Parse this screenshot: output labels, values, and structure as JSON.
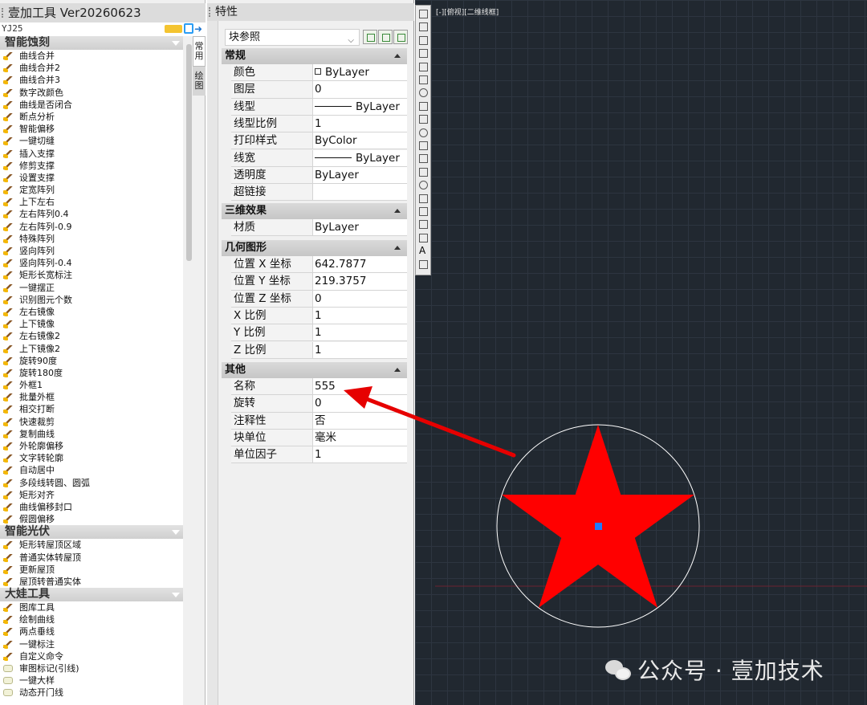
{
  "left_panel": {
    "title": "壹加工具 Ver20260623",
    "version_tag": "YJ25",
    "side_tabs": [
      "常用",
      "绘图"
    ],
    "groups": [
      {
        "name": "智能蚀刻",
        "items": [
          "曲线合并",
          "曲线合并2",
          "曲线合并3",
          "数字改颜色",
          "曲线是否闭合",
          "断点分析",
          "智能偏移",
          "一键切缝",
          "插入支撑",
          "修剪支撑",
          "设置支撑",
          "定宽阵列",
          "上下左右",
          "左右阵列0.4",
          "左右阵列-0.9",
          "特殊阵列",
          "竖向阵列",
          "竖向阵列-0.4",
          "矩形长宽标注",
          "一键摆正",
          "识别图元个数",
          "左右镜像",
          "上下镜像",
          "左右镜像2",
          "上下镜像2",
          "旋转90度",
          "旋转180度",
          "外框1",
          "批量外框",
          "相交打断",
          "快速裁剪",
          "复制曲线",
          "外轮廓偏移",
          "文字转轮廓",
          "自动居中",
          "多段线转圆、圆弧",
          "矩形对齐",
          "曲线偏移封口",
          "假圆偏移"
        ]
      },
      {
        "name": "智能光伏",
        "items": [
          "矩形转屋顶区域",
          "普通实体转屋顶",
          "更新屋顶",
          "屋顶转普通实体"
        ]
      },
      {
        "name": "大娃工具",
        "items": [
          "图库工具",
          "绘制曲线",
          "两点垂线",
          "一键标注",
          "自定义命令",
          "审图标记(引线)",
          "一键大样",
          "动态开门线"
        ]
      }
    ]
  },
  "props_panel": {
    "title": "特性",
    "selector_value": "块参照",
    "sections": [
      {
        "name": "常规",
        "rows": [
          {
            "name": "颜色",
            "value": "ByLayer",
            "marker": "square"
          },
          {
            "name": "图层",
            "value": "0"
          },
          {
            "name": "线型",
            "value": "ByLayer",
            "marker": "line"
          },
          {
            "name": "线型比例",
            "value": "1"
          },
          {
            "name": "打印样式",
            "value": "ByColor"
          },
          {
            "name": "线宽",
            "value": "ByLayer",
            "marker": "line"
          },
          {
            "name": "透明度",
            "value": "ByLayer"
          },
          {
            "name": "超链接",
            "value": ""
          }
        ]
      },
      {
        "name": "三维效果",
        "rows": [
          {
            "name": "材质",
            "value": "ByLayer"
          }
        ]
      },
      {
        "name": "几何图形",
        "rows": [
          {
            "name": "位置 X 坐标",
            "value": "642.7877"
          },
          {
            "name": "位置 Y 坐标",
            "value": "219.3757"
          },
          {
            "name": "位置 Z 坐标",
            "value": "0"
          },
          {
            "name": "X 比例",
            "value": "1"
          },
          {
            "name": "Y 比例",
            "value": "1"
          },
          {
            "name": "Z 比例",
            "value": "1"
          }
        ]
      },
      {
        "name": "其他",
        "rows": [
          {
            "name": "名称",
            "value": "555"
          },
          {
            "name": "旋转",
            "value": "0"
          },
          {
            "name": "注释性",
            "value": "否"
          },
          {
            "name": "块单位",
            "value": "毫米"
          },
          {
            "name": "单位因子",
            "value": "1"
          }
        ]
      }
    ]
  },
  "canvas": {
    "view_label": "[-][俯视][二维线框]",
    "star_color": "#ff0000",
    "circle_color": "#ffffff",
    "grip_color": "#1e7bff",
    "background": "#212830"
  },
  "annotation": {
    "arrow_color": "#e60000"
  },
  "watermark": {
    "text": "公众号 · 壹加技术"
  }
}
